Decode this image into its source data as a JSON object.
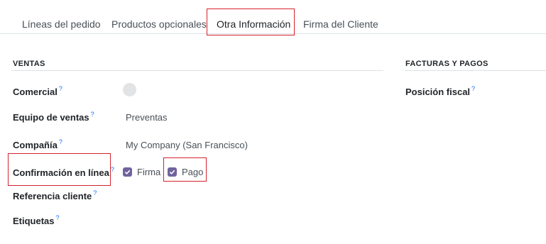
{
  "tabs": [
    {
      "label": "Líneas del pedido"
    },
    {
      "label": "Productos opcionales"
    },
    {
      "label": "Otra Información"
    },
    {
      "label": "Firma del Cliente"
    }
  ],
  "ventas": {
    "title": "VENTAS",
    "fields": {
      "comercial": {
        "label": "Comercial",
        "help": "?"
      },
      "equipo": {
        "label": "Equipo de ventas",
        "help": "?",
        "value": "Preventas"
      },
      "compania": {
        "label": "Compañía",
        "help": "?",
        "value": "My Company (San Francisco)"
      },
      "confirmacion": {
        "label": "Confirmación en línea",
        "help": "?",
        "firma": "Firma",
        "pago": "Pago",
        "firma_checked": true,
        "pago_checked": true
      },
      "referencia": {
        "label": "Referencia cliente",
        "help": "?"
      },
      "etiquetas": {
        "label": "Etiquetas",
        "help": "?"
      }
    }
  },
  "facturas": {
    "title": "FACTURAS Y PAGOS",
    "fields": {
      "posicion": {
        "label": "Posición fiscal",
        "help": "?"
      }
    }
  },
  "colors": {
    "accent": "#71639e",
    "highlight": "#d6212d"
  }
}
